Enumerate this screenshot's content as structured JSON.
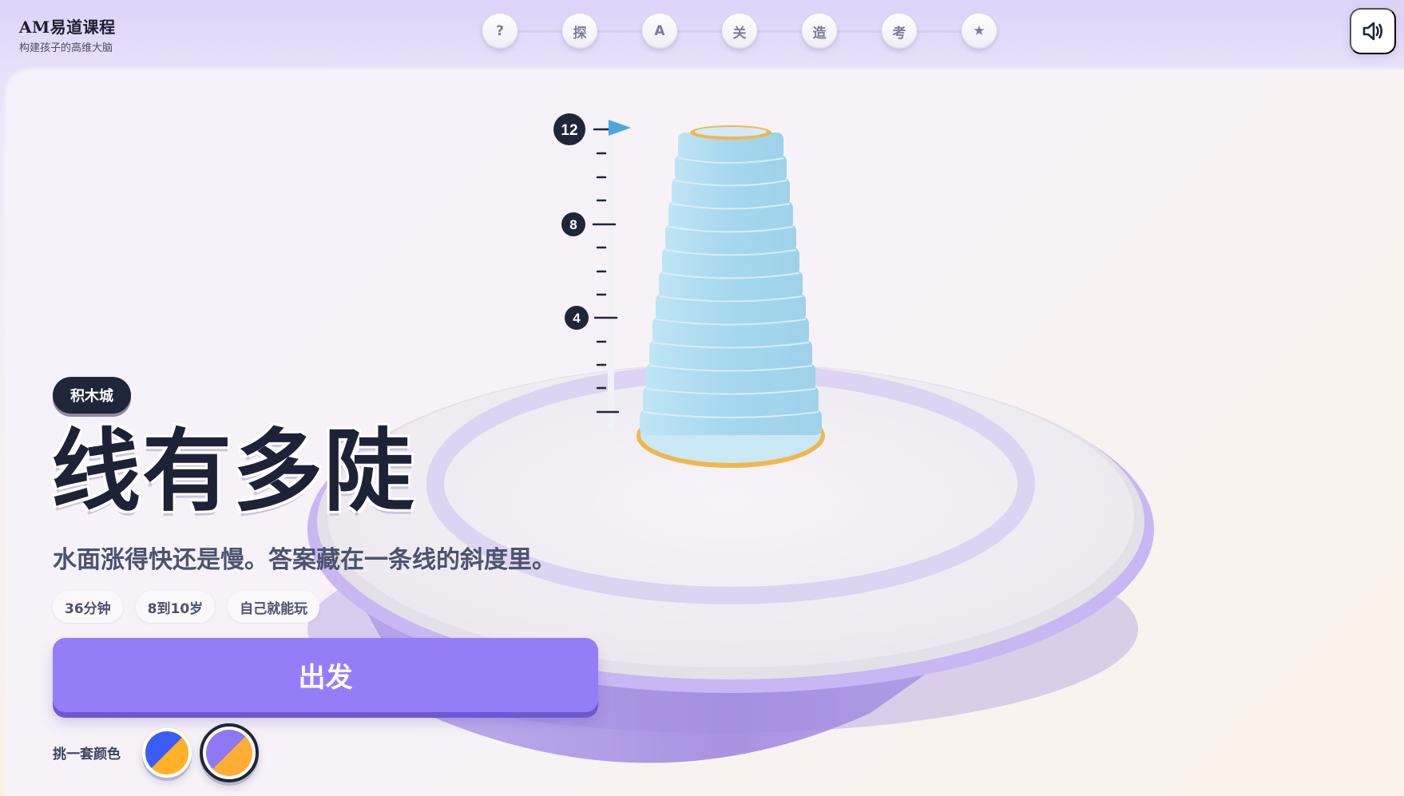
{
  "brand": {
    "title": "AM易道课程",
    "subtitle": "构建孩子的高维大脑"
  },
  "steps": [
    "?",
    "探",
    "A",
    "关",
    "造",
    "考",
    "★"
  ],
  "sound_button": {
    "icon": "speaker-icon"
  },
  "scene": {
    "ruler_labels": [
      "12",
      "8",
      "4"
    ],
    "flag_icon": "flag-icon",
    "colors": {
      "cylinder": "#a9daf0",
      "rim": "#f2b650",
      "platform_top": "#f0eef2",
      "platform_side": "#a98fe0",
      "marker": "#1f2639"
    }
  },
  "hero": {
    "tag": "积木城",
    "title": "线有多陡",
    "subtitle": "水面涨得快还是慢。答案藏在一条线的斜度里。",
    "chips": [
      "36分钟",
      "8到10岁",
      "自己就能玩"
    ],
    "start_button": "出发",
    "accent": "#947ef8"
  },
  "palette": {
    "label": "挑一套颜色",
    "options": [
      {
        "name": "blue-orange",
        "colors": [
          "#3b5cf5",
          "#ffb12a"
        ],
        "selected": false
      },
      {
        "name": "purple-orange",
        "colors": [
          "#8e78f4",
          "#ffad33"
        ],
        "selected": true
      }
    ]
  }
}
